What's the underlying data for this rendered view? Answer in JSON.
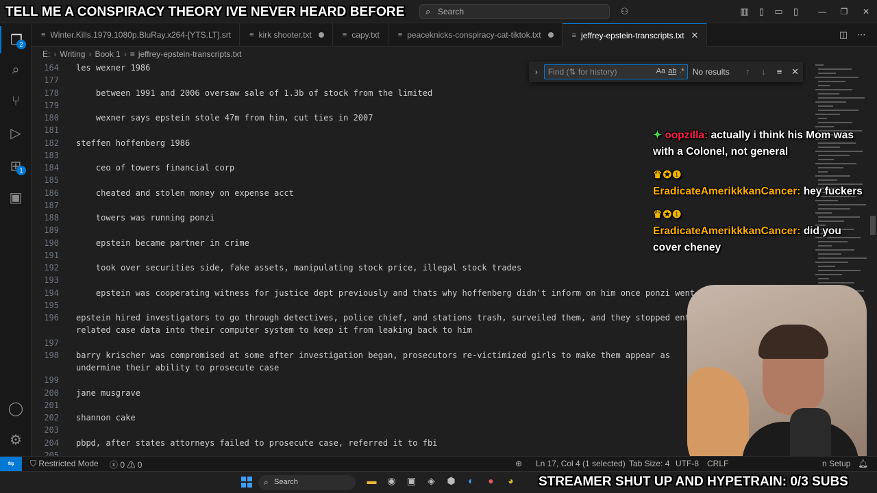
{
  "stream": {
    "top_caption": "TELL ME A CONSPIRACY THEORY IVE NEVER HEARD BEFORE",
    "bottom_caption": "STREAMER SHUT UP AND HYPETRAIN: 0/3 SUBS"
  },
  "titlebar": {
    "search_label": "Search"
  },
  "activity_bar": {
    "explorer_badge": "2",
    "extensions_badge": "1"
  },
  "tabs": [
    {
      "label": "Winter.Kills.1979.1080p.BluRay.x264-[YTS.LT].srt"
    },
    {
      "label": "kirk shooter.txt"
    },
    {
      "label": "capy.txt"
    },
    {
      "label": "peaceknicks-conspiracy-cat-tiktok.txt"
    },
    {
      "label": "jeffrey-epstein-transcripts.txt"
    }
  ],
  "breadcrumb": [
    "E:",
    "Writing",
    "Book 1",
    "jeffrey-epstein-transcripts.txt"
  ],
  "find": {
    "placeholder": "Find (⇅ for history)",
    "match_case": "Aa",
    "whole_word": "ab",
    "regex": ".*",
    "result": "No results"
  },
  "editor": {
    "lines": [
      {
        "n": "164",
        "text": "les wexner 1986"
      },
      {
        "n": "177",
        "text": ""
      },
      {
        "n": "178",
        "text": "    between 1991 and 2006 oversaw sale of 1.3b of stock from the limited"
      },
      {
        "n": "179",
        "text": ""
      },
      {
        "n": "180",
        "text": "    wexner says epstein stole 47m from him, cut ties in 2007"
      },
      {
        "n": "181",
        "text": ""
      },
      {
        "n": "182",
        "text": "steffen hoffenberg 1986"
      },
      {
        "n": "183",
        "text": ""
      },
      {
        "n": "184",
        "text": "    ceo of towers financial corp"
      },
      {
        "n": "185",
        "text": ""
      },
      {
        "n": "186",
        "text": "    cheated and stolen money on expense acct"
      },
      {
        "n": "187",
        "text": ""
      },
      {
        "n": "188",
        "text": "    towers was running ponzi"
      },
      {
        "n": "189",
        "text": ""
      },
      {
        "n": "190",
        "text": "    epstein became partner in crime"
      },
      {
        "n": "191",
        "text": ""
      },
      {
        "n": "192",
        "text": "    took over securities side, fake assets, manipulating stock price, illegal stock trades"
      },
      {
        "n": "193",
        "text": ""
      },
      {
        "n": "194",
        "text": "    epstein was cooperating witness for justice dept previously and thats why hoffenberg didn't inform on him once ponzi went bust"
      },
      {
        "n": "195",
        "text": ""
      },
      {
        "n": "196",
        "text": "epstein hired investigators to go through detectives, police chief, and stations trash, surveiled them, and they stopped entering"
      },
      {
        "n": "",
        "text": "related case data into their computer system to keep it from leaking back to him"
      },
      {
        "n": "197",
        "text": ""
      },
      {
        "n": "198",
        "text": "barry krischer was compromised at some after investigation began, prosecutors re-victimized girls to make them appear as"
      },
      {
        "n": "",
        "text": "undermine their ability to prosecute case"
      },
      {
        "n": "199",
        "text": ""
      },
      {
        "n": "200",
        "text": "jane musgrave"
      },
      {
        "n": "201",
        "text": ""
      },
      {
        "n": "202",
        "text": "shannon cake"
      },
      {
        "n": "203",
        "text": ""
      },
      {
        "n": "204",
        "text": "pbpd, after states attorneys failed to prosecute case, referred it to fbi"
      },
      {
        "n": "205",
        "text": ""
      }
    ]
  },
  "chat": [
    {
      "user": "oopzilla",
      "text": "actually i think his Mom was with a Colonel, not general"
    },
    {
      "user": "EradicateAmerikkkanCancer",
      "text": "hey fuckers"
    },
    {
      "user": "EradicateAmerikkkanCancer",
      "text": "did you cover cheney"
    }
  ],
  "statusbar": {
    "restricted": "Restricted Mode",
    "errors": "0",
    "warnings": "0",
    "position": "Ln 17, Col 4 (1 selected)",
    "tab_size": "Tab Size: 4",
    "encoding": "UTF-8",
    "eol": "CRLF",
    "setup": "n Setup"
  },
  "taskbar": {
    "search_label": "Search"
  }
}
